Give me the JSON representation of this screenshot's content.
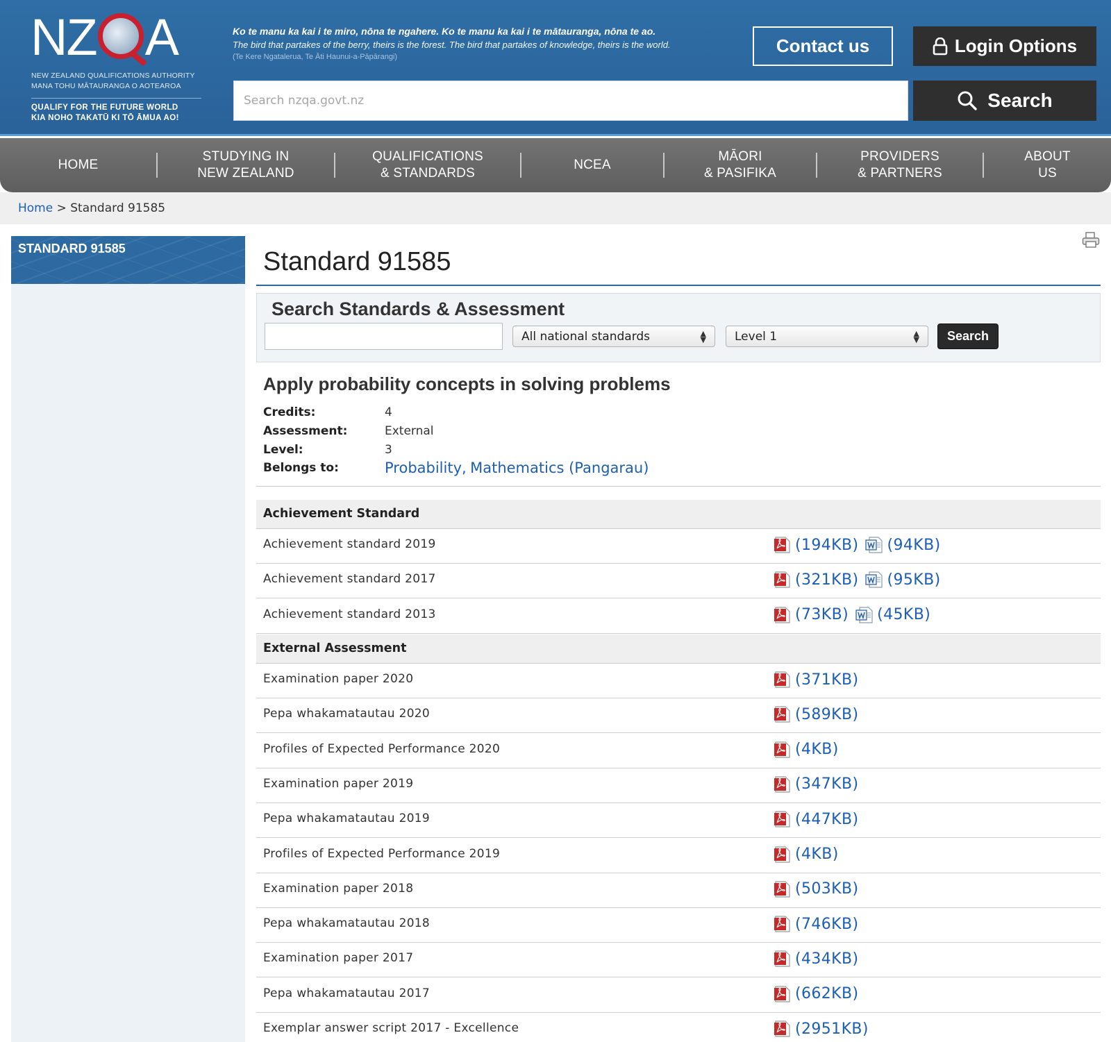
{
  "header": {
    "logo_text": "NZQA",
    "logo_sub1": "NEW ZEALAND QUALIFICATIONS AUTHORITY",
    "logo_sub2": "MANA TOHU MĀTAURANGA O AOTEAROA",
    "logo_tag1": "QUALIFY FOR THE FUTURE WORLD",
    "logo_tag2": "KIA NOHO TAKATŪ KI TŌ ĀMUA AO!",
    "whakatauki_line1": "Ko te manu ka kai i te miro, nōna te ngahere. Ko te manu ka kai i te mātauranga, nōna te ao.",
    "whakatauki_line2": "The bird that partakes of the berry, theirs is the forest. The bird that partakes of knowledge, theirs is the world.",
    "whakatauki_line3": "(Te Kere Ngatalerua, Te Āti Haunui-a-Pāpārangi)",
    "contact_label": "Contact us",
    "login_label": "Login Options",
    "search_placeholder": "Search nzqa.govt.nz",
    "search_label": "Search"
  },
  "nav": {
    "items": [
      {
        "line1": "HOME",
        "line2": ""
      },
      {
        "line1": "STUDYING IN",
        "line2": "NEW ZEALAND"
      },
      {
        "line1": "QUALIFICATIONS",
        "line2": "& STANDARDS"
      },
      {
        "line1": "NCEA",
        "line2": ""
      },
      {
        "line1": "MĀORI",
        "line2": "& PASIFIKA"
      },
      {
        "line1": "PROVIDERS",
        "line2": "& PARTNERS"
      },
      {
        "line1": "ABOUT",
        "line2": "US"
      }
    ]
  },
  "breadcrumb": {
    "home": "Home",
    "separator": ">",
    "current": "Standard 91585"
  },
  "sidebar": {
    "title": "STANDARD 91585"
  },
  "main": {
    "title": "Standard 91585",
    "search_panel": {
      "title": "Search Standards & Assessment",
      "input_value": "",
      "type_select": "All national standards",
      "level_select": "Level 1",
      "button": "Search"
    },
    "standard": {
      "heading": "Apply probability concepts in solving problems",
      "credits_label": "Credits:",
      "credits": "4",
      "assessment_label": "Assessment:",
      "assessment": "External",
      "level_label": "Level:",
      "level": "3",
      "belongs_label": "Belongs to:",
      "belongs_1": "Probability",
      "belongs_sep": ",",
      "belongs_2": "Mathematics (Pangarau)"
    },
    "achievement_section": {
      "heading": "Achievement Standard",
      "rows": [
        {
          "label": "Achievement standard 2019",
          "pdf": "(194KB)",
          "doc": "(94KB)"
        },
        {
          "label": "Achievement standard 2017",
          "pdf": "(321KB)",
          "doc": "(95KB)"
        },
        {
          "label": "Achievement standard 2013",
          "pdf": "(73KB)",
          "doc": "(45KB)"
        }
      ]
    },
    "external_section": {
      "heading": "External Assessment",
      "rows": [
        {
          "label": "Examination paper 2020",
          "pdf": "(371KB)"
        },
        {
          "label": "Pepa whakamatautau 2020",
          "pdf": "(589KB)"
        },
        {
          "label": "Profiles of Expected Performance 2020",
          "pdf": "(4KB)"
        },
        {
          "label": "Examination paper 2019",
          "pdf": "(347KB)"
        },
        {
          "label": "Pepa whakamatautau 2019",
          "pdf": "(447KB)"
        },
        {
          "label": "Profiles of Expected Performance 2019",
          "pdf": "(4KB)"
        },
        {
          "label": "Examination paper 2018",
          "pdf": "(503KB)"
        },
        {
          "label": "Pepa whakamatautau 2018",
          "pdf": "(746KB)"
        },
        {
          "label": "Examination paper 2017",
          "pdf": "(434KB)"
        },
        {
          "label": "Pepa whakamatautau 2017",
          "pdf": "(662KB)"
        },
        {
          "label": "Exemplar answer script 2017 - Excellence",
          "pdf": "(2951KB)"
        }
      ]
    }
  },
  "colors": {
    "header_blue": "#2d6aa0",
    "nav_grey": "#666666",
    "link_blue": "#1d5fb4",
    "dark_button": "#2f2f2f",
    "logo_red": "#c8202f"
  },
  "icons": {
    "login": "lock-icon",
    "search": "magnifier-icon",
    "print": "printer-icon",
    "pdf": "pdf-file-icon",
    "doc": "word-doc-icon"
  }
}
